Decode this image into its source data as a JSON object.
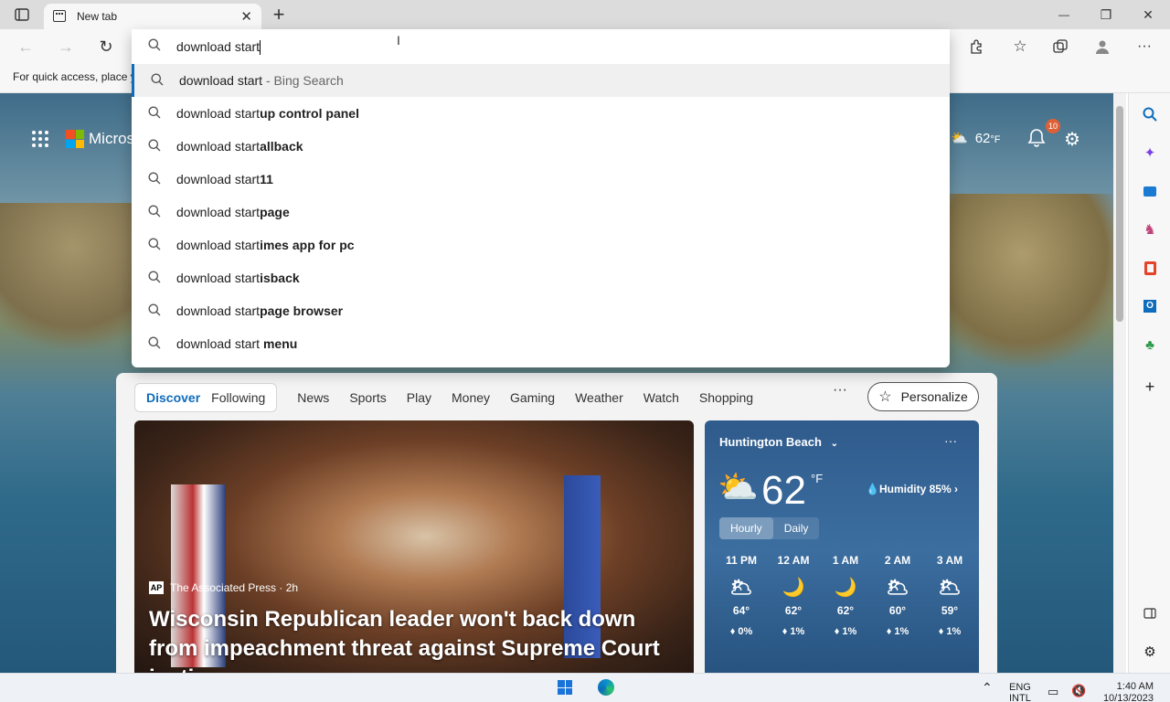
{
  "tab": {
    "title": "New tab",
    "close": "✕",
    "new": "+"
  },
  "window": {
    "minimize": "—",
    "maximize": "❐",
    "close": "✕"
  },
  "favbar": {
    "text": "For quick access, place y"
  },
  "search": {
    "query": "download start",
    "suggestions": [
      {
        "prefix": "download start",
        "bold": "",
        "suffix": " - Bing Search"
      },
      {
        "prefix": "download start",
        "bold": "up control panel",
        "suffix": ""
      },
      {
        "prefix": "download start",
        "bold": "allback",
        "suffix": ""
      },
      {
        "prefix": "download start",
        "bold": "11",
        "suffix": ""
      },
      {
        "prefix": "download start",
        "bold": "page",
        "suffix": ""
      },
      {
        "prefix": "download start",
        "bold": "imes app for pc",
        "suffix": ""
      },
      {
        "prefix": "download start",
        "bold": "isback",
        "suffix": ""
      },
      {
        "prefix": "download start",
        "bold": "page browser",
        "suffix": ""
      },
      {
        "prefix": "download start ",
        "bold": "menu",
        "suffix": ""
      }
    ]
  },
  "ntp": {
    "logo_text": "Micros",
    "weather_temp": "62",
    "weather_unit": "°F",
    "notifications": "10"
  },
  "feed": {
    "tabs": [
      "Discover",
      "Following"
    ],
    "nav": [
      "News",
      "Sports",
      "Play",
      "Money",
      "Gaming",
      "Weather",
      "Watch",
      "Shopping"
    ],
    "more": "···",
    "personalize": "Personalize",
    "hero": {
      "source_logo": "AP",
      "source": "The Associated Press · 2h",
      "headline": "Wisconsin Republican leader won't back down from impeachment threat against Supreme Court justice"
    },
    "weather": {
      "city": "Huntington Beach",
      "temp": "62",
      "unit": "°F",
      "humidity": "Humidity 85%",
      "tab_hourly": "Hourly",
      "tab_daily": "Daily",
      "more": "···",
      "hours": [
        {
          "time": "11 PM",
          "temp": "64°",
          "precip": "0%"
        },
        {
          "time": "12 AM",
          "temp": "62°",
          "precip": "1%"
        },
        {
          "time": "1 AM",
          "temp": "62°",
          "precip": "1%"
        },
        {
          "time": "2 AM",
          "temp": "60°",
          "precip": "1%"
        },
        {
          "time": "3 AM",
          "temp": "59°",
          "precip": "1%"
        }
      ]
    }
  },
  "taskbar": {
    "lang1": "ENG",
    "lang2": "INTL",
    "time": "1:40 AM",
    "date": "10/13/2023"
  },
  "colors": {
    "accent": "#0f6cbd",
    "badge": "#e06036"
  }
}
